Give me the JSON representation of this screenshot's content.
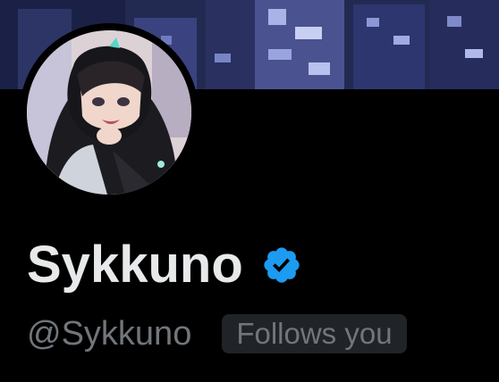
{
  "profile": {
    "display_name": "Sykkuno",
    "handle": "@Sykkuno",
    "follows_you": "Follows you",
    "verified_badge_icon": "verified-check-badge"
  },
  "colors": {
    "background": "#000000",
    "name_text": "#e7e9ea",
    "secondary_text": "#71767b",
    "badge_background": "#202327",
    "verified_blue": "#1d9bf0"
  }
}
